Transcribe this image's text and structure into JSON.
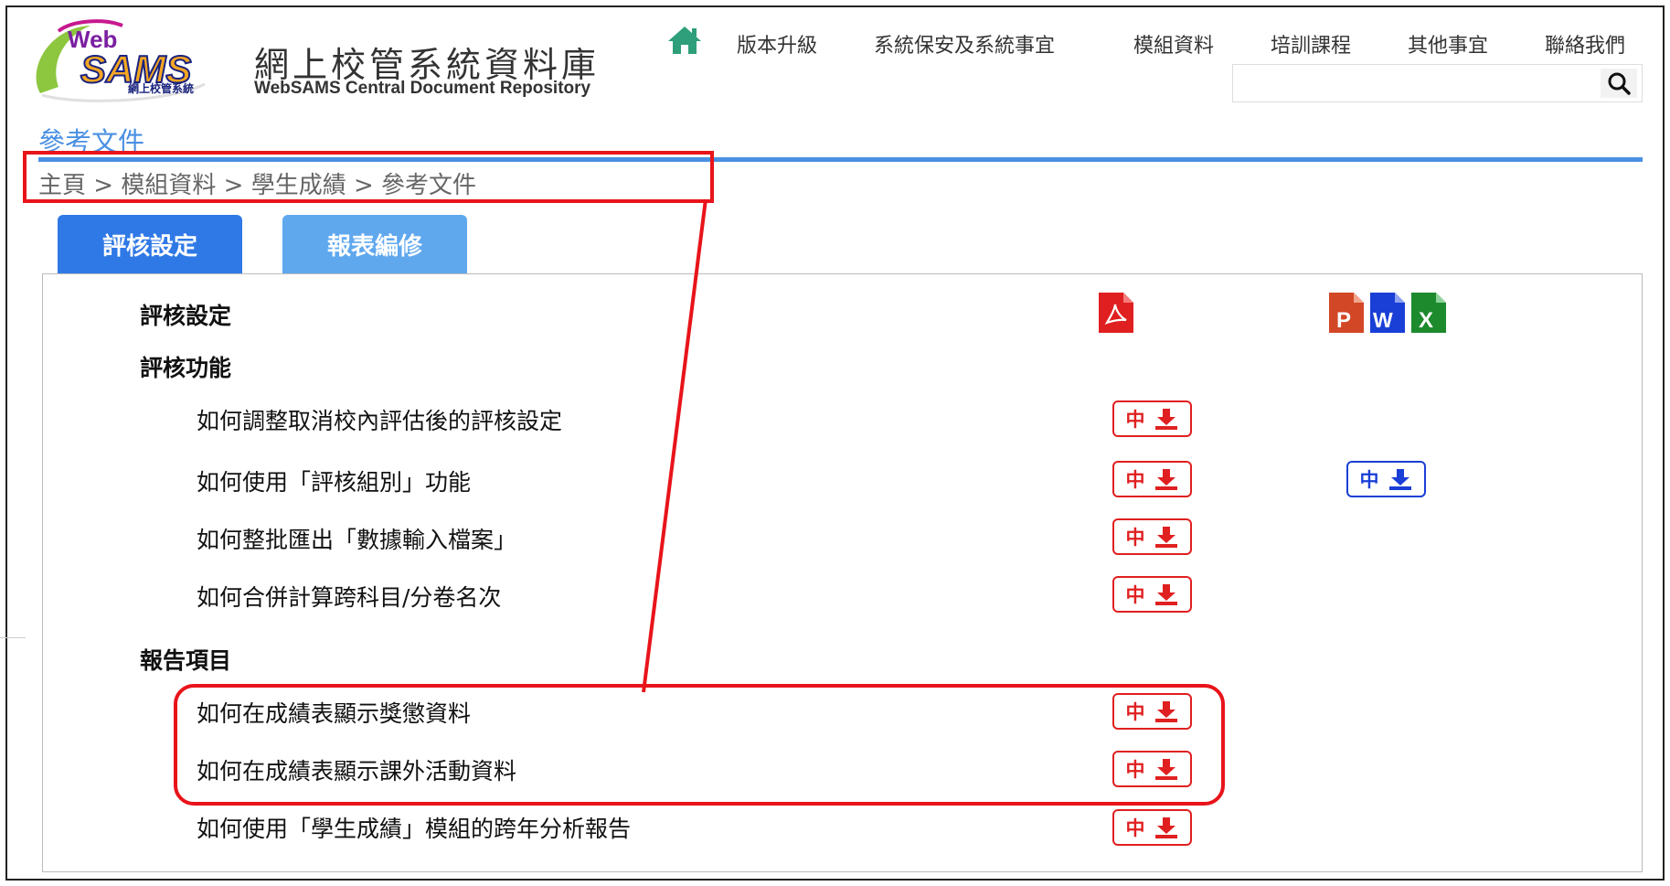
{
  "logo": {
    "web": "Web",
    "sams": "SAMS",
    "tiny_caption": "網上校管系統",
    "title": "網上校管系統資料庫",
    "subtitle": "WebSAMS Central Document Repository"
  },
  "nav": {
    "home_icon": "home-icon",
    "items": [
      {
        "label": "版本升級"
      },
      {
        "label": "系統保安及系統事宜"
      },
      {
        "label": "模組資料"
      },
      {
        "label": "培訓課程"
      },
      {
        "label": "其他事宜"
      },
      {
        "label": "聯絡我們"
      }
    ]
  },
  "search": {
    "placeholder": "",
    "value": "",
    "icon": "search-icon"
  },
  "page": {
    "heading": "參考文件",
    "breadcrumb": [
      "主頁",
      "模組資料",
      "學生成績",
      "參考文件"
    ],
    "breadcrumb_sep": ">"
  },
  "tabs": [
    {
      "label": "評核設定",
      "active": true
    },
    {
      "label": "報表編修",
      "active": false
    }
  ],
  "file_icons": {
    "pdf": {
      "icon": "pdf-icon",
      "color": "#e02020"
    },
    "ppt": {
      "icon": "powerpoint-icon",
      "letter": "P",
      "color": "#d24726"
    },
    "word": {
      "icon": "word-icon",
      "letter": "W",
      "color": "#1a3fd6"
    },
    "excel": {
      "icon": "excel-icon",
      "letter": "X",
      "color": "#1e8a2e"
    }
  },
  "sections": [
    {
      "title": "評核設定"
    },
    {
      "title": "評核功能"
    },
    {
      "title": "報告項目"
    }
  ],
  "docs": [
    {
      "title": "如何調整取消校內評估後的評核設定",
      "pdf_label": "中"
    },
    {
      "title": "如何使用「評核組別」功能",
      "pdf_label": "中",
      "office_label": "中"
    },
    {
      "title": "如何整批匯出「數據輸入檔案」",
      "pdf_label": "中"
    },
    {
      "title": "如何合併計算跨科目/分卷名次",
      "pdf_label": "中"
    },
    {
      "title": "如何在成績表顯示獎懲資料",
      "pdf_label": "中"
    },
    {
      "title": "如何在成績表顯示課外活動資料",
      "pdf_label": "中"
    },
    {
      "title": "如何使用「學生成績」模組的跨年分析報告",
      "pdf_label": "中"
    }
  ],
  "colors": {
    "accent": "#4a90e2",
    "tab_active": "#2f79e6",
    "tab_inactive": "#5fa8ee",
    "pdf_red": "#e02020",
    "annotation_red": "#e8141a"
  }
}
